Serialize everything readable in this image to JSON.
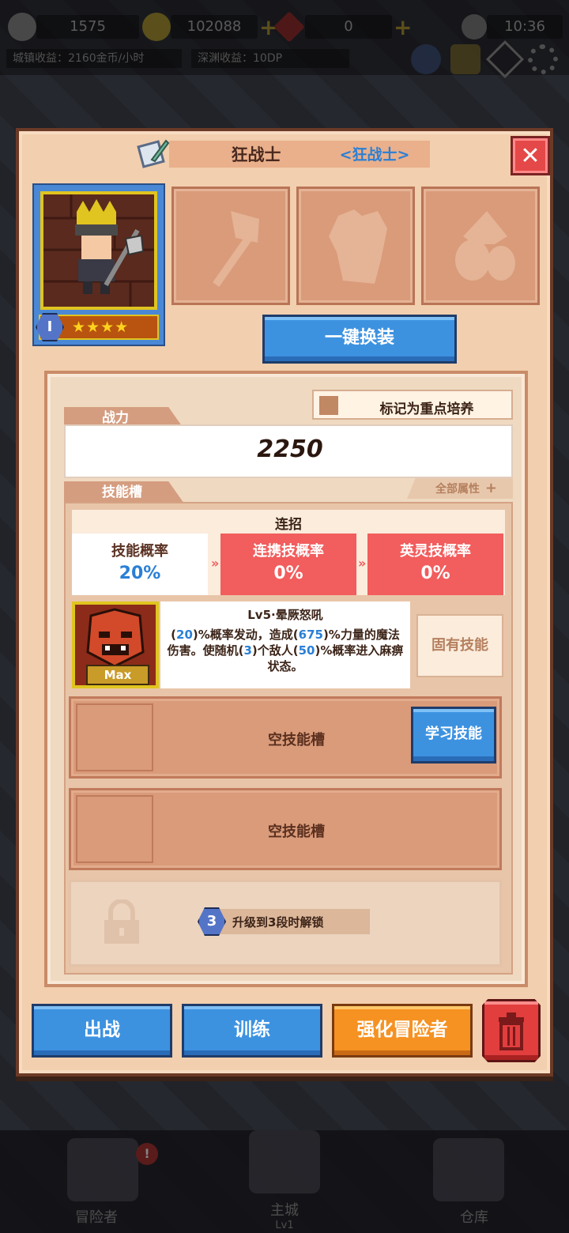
{
  "hud": {
    "resource1": "1575",
    "gold": "102088",
    "gems": "0",
    "time": "10:36",
    "town_income": "城镇收益：2160金币/小时",
    "abyss_income": "深渊收益：10DP"
  },
  "nav": {
    "adventurer": "冒险者",
    "main_city": "主城",
    "main_city_level": "Lv1",
    "warehouse": "仓库"
  },
  "panel": {
    "title": "狂战士",
    "class_label": "<狂战士>",
    "hero_stage": "Ⅰ",
    "hero_stars": "★★★★",
    "one_click_equip": "一键换装",
    "mark_label": "标记为重点培养",
    "power_tab": "战力",
    "power_value": "2250",
    "skill_tab": "技能槽",
    "all_attributes": "全部属性",
    "combo": {
      "title": "连招",
      "cells": [
        {
          "label": "技能概率",
          "value": "20%"
        },
        {
          "label": "连携技概率",
          "value": "0%"
        },
        {
          "label": "英灵技概率",
          "value": "0%"
        }
      ]
    },
    "skill": {
      "name": "Lv5·晕厥怒吼",
      "max": "Max",
      "desc_parts": [
        "(",
        "20",
        ")%概率发动，造成(",
        "675",
        ")%力量的魔法伤害。使随机(",
        "3",
        ")个敌人(",
        "50",
        ")%概率进入麻痹状态。"
      ],
      "innate": "固有技能"
    },
    "empty_slot_1": "空技能槽",
    "learn_skill": "学习技能",
    "empty_slot_2": "空技能槽",
    "unlock_badge": "3",
    "unlock_text": "升级到3段时解锁",
    "buttons": {
      "deploy": "出战",
      "train": "训练",
      "enhance": "强化冒险者"
    }
  },
  "colors": {
    "panel_bg": "#f2cfae",
    "blue_button": "#3d92e0",
    "orange_button": "#f59222",
    "red_cell": "#f25d5d",
    "accent_blue_text": "#2a7fd6"
  }
}
